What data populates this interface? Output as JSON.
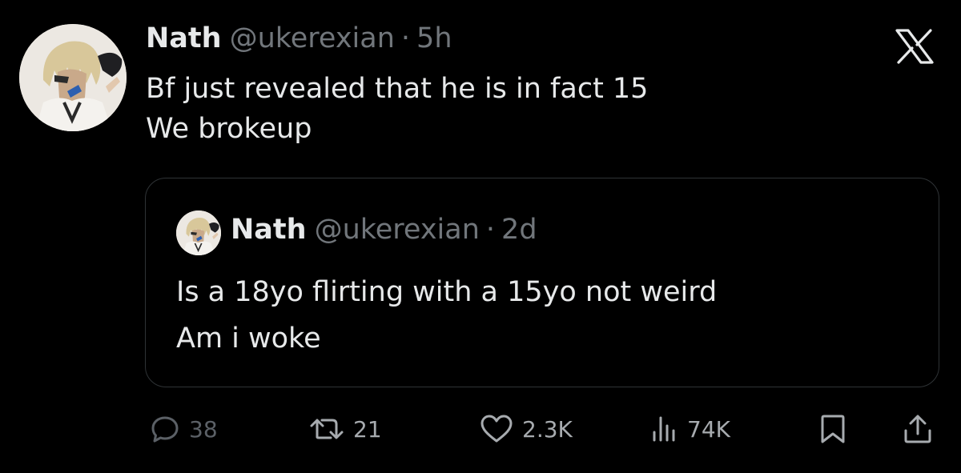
{
  "tweet": {
    "author_name": "Nath",
    "handle": "@ukerexian",
    "separator": "·",
    "time": "5h",
    "text_lines": [
      "Bf just revealed that he is in fact 15",
      "We brokeup"
    ],
    "avatar_icon": "profile-avatar-image"
  },
  "quoted_tweet": {
    "author_name": "Nath",
    "handle": "@ukerexian",
    "separator": "·",
    "time": "2d",
    "text_lines": [
      "Is a 18yo flirting with a 15yo not weird",
      "Am i woke"
    ],
    "avatar_icon": "profile-avatar-image"
  },
  "brand": {
    "icon": "x-logo-icon"
  },
  "actions": {
    "replies": {
      "icon": "reply-icon",
      "count": "38"
    },
    "reposts": {
      "icon": "repost-icon",
      "count": "21"
    },
    "likes": {
      "icon": "heart-icon",
      "count": "2.3K"
    },
    "views": {
      "icon": "views-icon",
      "count": "74K"
    },
    "bookmark": {
      "icon": "bookmark-icon"
    },
    "share": {
      "icon": "share-icon"
    }
  },
  "colors": {
    "background": "#000000",
    "primary_text": "#e7e9ea",
    "secondary_text": "#71767b",
    "border": "#2f3336"
  }
}
